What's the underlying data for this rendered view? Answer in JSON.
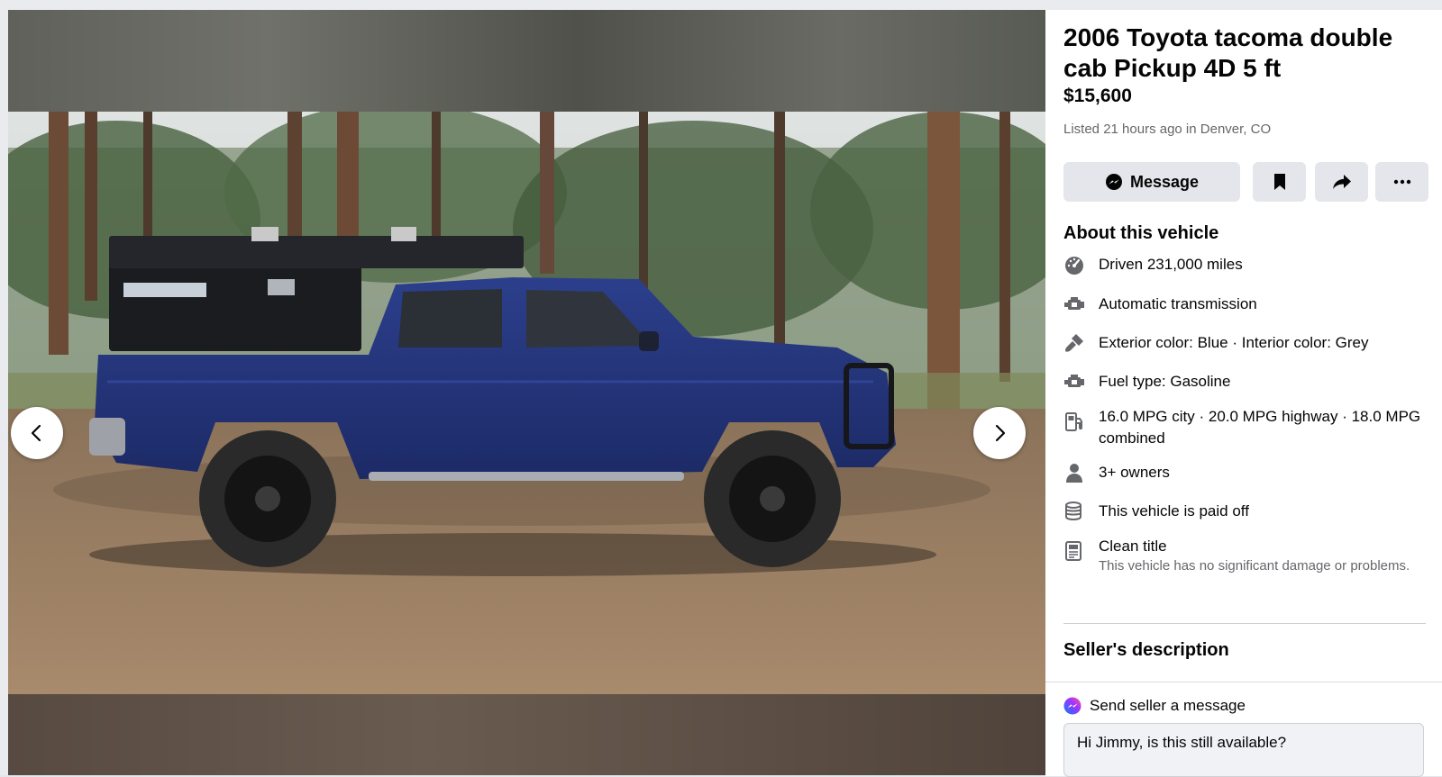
{
  "listing": {
    "title": "2006 Toyota tacoma double cab Pickup 4D 5 ft",
    "price": "$15,600",
    "listed": "Listed 21 hours ago in Denver, CO"
  },
  "actions": {
    "message_label": "Message",
    "save_icon": "bookmark-icon",
    "share_icon": "share-icon",
    "more_icon": "more-icon"
  },
  "about": {
    "heading": "About this vehicle",
    "items": [
      {
        "icon": "speedometer-icon",
        "text": "Driven 231,000 miles"
      },
      {
        "icon": "engine-icon",
        "text": "Automatic transmission"
      },
      {
        "icon": "paint-icon",
        "text": "Exterior color: Blue · Interior color: Grey"
      },
      {
        "icon": "engine-icon",
        "text": "Fuel type: Gasoline"
      },
      {
        "icon": "fuel-pump-icon",
        "text": "16.0 MPG city · 20.0 MPG highway · 18.0 MPG combined"
      },
      {
        "icon": "person-icon",
        "text": "3+ owners"
      },
      {
        "icon": "coins-icon",
        "text": "This vehicle is paid off"
      },
      {
        "icon": "document-icon",
        "text": "Clean title",
        "subtext": "This vehicle has no significant damage or problems."
      }
    ]
  },
  "seller": {
    "heading": "Seller's description"
  },
  "send": {
    "label": "Send seller a message",
    "message_value": "Hi Jimmy, is this still available?"
  }
}
